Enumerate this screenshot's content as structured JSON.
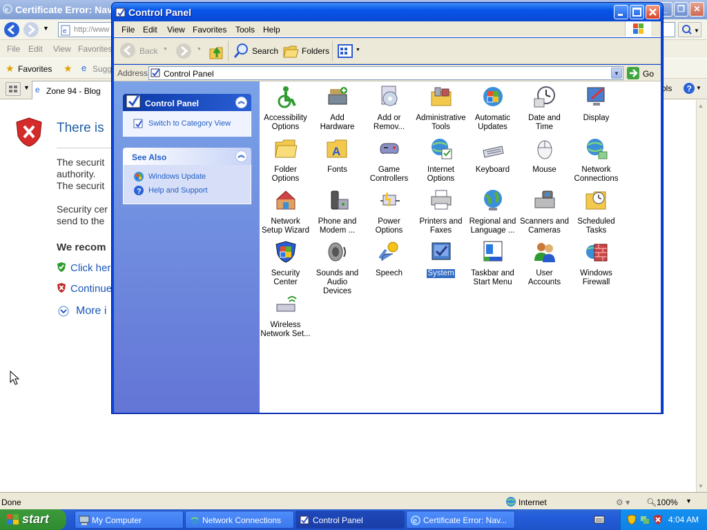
{
  "ie": {
    "title": "Certificate Error: Navi",
    "address": "http://www",
    "menu": [
      "File",
      "Edit",
      "View",
      "Favorites"
    ],
    "favorites_label": "Favorites",
    "suggested": "Sugge",
    "tab_label": "Zone 94 - Blog",
    "tools_fragment": "ols",
    "content": {
      "heading": "There is",
      "p1_line1": "The securit",
      "p1_line2": "authority.",
      "p1_line3": "The securit",
      "p2_line1": "Security cer",
      "p2_line2": "send to the",
      "recommend": "We recom",
      "link_click": "Click her",
      "link_continue": "Continue",
      "link_more": "More i"
    },
    "status": {
      "left": "Done",
      "zone": "Internet",
      "zoom": "100%"
    }
  },
  "cp": {
    "title": "Control Panel",
    "menu": [
      "File",
      "Edit",
      "View",
      "Favorites",
      "Tools",
      "Help"
    ],
    "toolbar": {
      "back": "Back",
      "search": "Search",
      "folders": "Folders"
    },
    "address_label": "Address",
    "address_value": "Control Panel",
    "go_label": "Go",
    "taskpane": {
      "panel_title": "Control Panel",
      "switch_link": "Switch to Category View",
      "see_also_title": "See Also",
      "see_also": [
        "Windows Update",
        "Help and Support"
      ]
    },
    "items": [
      {
        "label": "Accessibility Options",
        "icon": "accessibility-icon"
      },
      {
        "label": "Add Hardware",
        "icon": "add-hardware-icon"
      },
      {
        "label": "Add or Remov...",
        "icon": "add-remove-programs-icon"
      },
      {
        "label": "Administrative Tools",
        "icon": "administrative-tools-icon"
      },
      {
        "label": "Automatic Updates",
        "icon": "automatic-updates-icon"
      },
      {
        "label": "Date and Time",
        "icon": "date-time-icon"
      },
      {
        "label": "Display",
        "icon": "display-icon"
      },
      {
        "label": "Folder Options",
        "icon": "folder-options-icon"
      },
      {
        "label": "Fonts",
        "icon": "fonts-icon"
      },
      {
        "label": "Game Controllers",
        "icon": "game-controllers-icon"
      },
      {
        "label": "Internet Options",
        "icon": "internet-options-icon"
      },
      {
        "label": "Keyboard",
        "icon": "keyboard-icon"
      },
      {
        "label": "Mouse",
        "icon": "mouse-icon"
      },
      {
        "label": "Network Connections",
        "icon": "network-connections-icon"
      },
      {
        "label": "Network Setup Wizard",
        "icon": "network-setup-icon"
      },
      {
        "label": "Phone and Modem ...",
        "icon": "phone-modem-icon"
      },
      {
        "label": "Power Options",
        "icon": "power-options-icon"
      },
      {
        "label": "Printers and Faxes",
        "icon": "printers-faxes-icon"
      },
      {
        "label": "Regional and Language ...",
        "icon": "regional-language-icon"
      },
      {
        "label": "Scanners and Cameras",
        "icon": "scanners-cameras-icon"
      },
      {
        "label": "Scheduled Tasks",
        "icon": "scheduled-tasks-icon"
      },
      {
        "label": "Security Center",
        "icon": "security-center-icon"
      },
      {
        "label": "Sounds and Audio Devices",
        "icon": "sounds-audio-icon"
      },
      {
        "label": "Speech",
        "icon": "speech-icon"
      },
      {
        "label": "System",
        "icon": "system-icon",
        "selected": true
      },
      {
        "label": "Taskbar and Start Menu",
        "icon": "taskbar-start-menu-icon"
      },
      {
        "label": "User Accounts",
        "icon": "user-accounts-icon"
      },
      {
        "label": "Windows Firewall",
        "icon": "windows-firewall-icon"
      },
      {
        "label": "Wireless Network Set...",
        "icon": "wireless-network-icon"
      }
    ]
  },
  "taskbar": {
    "start": "start",
    "buttons": [
      {
        "label": "My Computer",
        "icon": "my-computer-icon"
      },
      {
        "label": "Network Connections",
        "icon": "network-connections-icon"
      },
      {
        "label": "Control Panel",
        "icon": "control-panel-icon",
        "active": true
      },
      {
        "label": "Certificate Error: Nav...",
        "icon": "ie-icon"
      }
    ],
    "clock": "4:04 AM"
  }
}
